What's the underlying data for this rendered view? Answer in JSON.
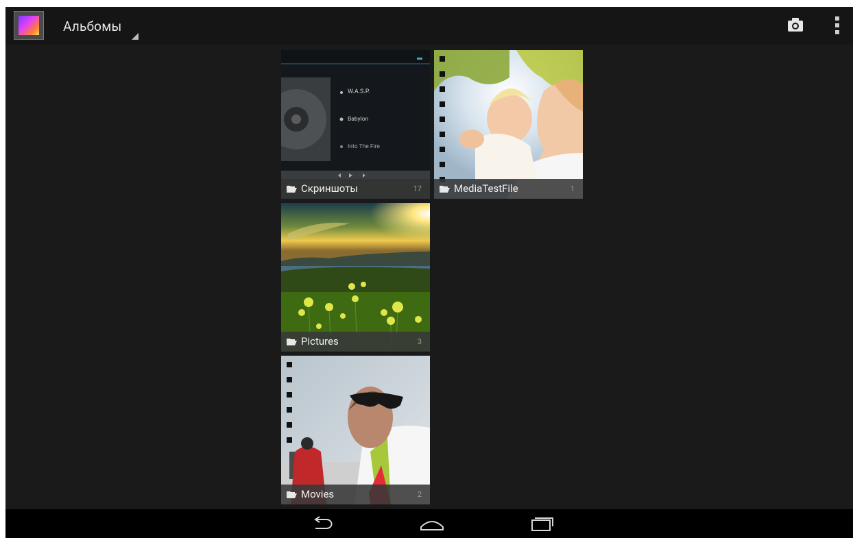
{
  "action_bar": {
    "title": "Альбомы",
    "app_icon": "gallery-icon",
    "actions": [
      {
        "id": "camera",
        "icon": "camera-icon"
      },
      {
        "id": "overflow",
        "icon": "overflow-menu-icon"
      }
    ]
  },
  "albums": [
    {
      "name": "Скриншоты",
      "count": "17",
      "thumb": {
        "artist": "W.A.S.P.",
        "album": "Babylon",
        "track": "Into The Fire"
      }
    },
    {
      "name": "MediaTestFile",
      "count": "1"
    },
    {
      "name": "Pictures",
      "count": "3"
    },
    {
      "name": "Movies",
      "count": "2"
    }
  ],
  "nav_bar": {
    "buttons": [
      {
        "id": "back",
        "icon": "back-icon"
      },
      {
        "id": "home",
        "icon": "home-icon"
      },
      {
        "id": "recents",
        "icon": "recents-icon"
      }
    ]
  },
  "colors": {
    "background": "#1a1a1a",
    "action_bar": "#151515",
    "label_bar": "#383838",
    "nav_bar": "#000000",
    "text": "#f2f2f2",
    "count_text": "#9a9a9a"
  }
}
